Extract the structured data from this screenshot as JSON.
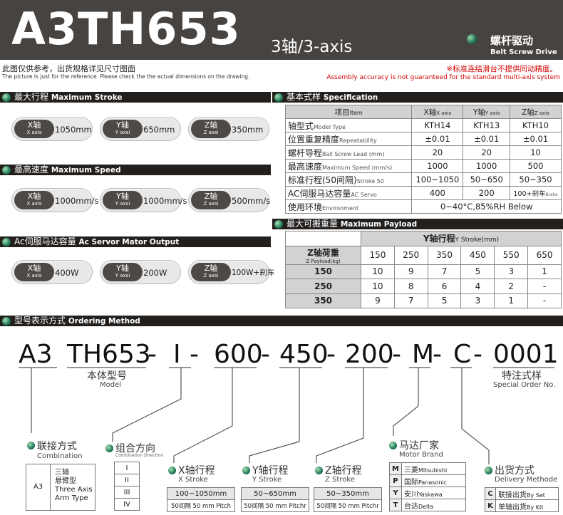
{
  "header": {
    "model": "A3TH653",
    "axis": "3轴/3-axis",
    "drive_cn": "螺杆驱动",
    "drive_en": "Belt Screw Drive"
  },
  "notes": {
    "picture_cn": "此图仅供参考，出货规格详见尺寸图面",
    "picture_en": "The picture is just for the reference. Please check the the actual dimensions on the drawing.",
    "warn_cn": "※标准连结滑台不提供同动精度。",
    "warn_en": "Assembly accuracy is not guaranteed for the standard multi-axis system"
  },
  "sections": {
    "stroke": {
      "cn": "最大行程",
      "en": "Maximum Stroke"
    },
    "speed": {
      "cn": "最高速度",
      "en": "Maximum Speed"
    },
    "servo": {
      "cn": "Ac伺服马达容量",
      "en": "Ac Servor Mator Output"
    },
    "spec": {
      "cn": "基本式样",
      "en": "Specification"
    },
    "payload": {
      "cn": "最大可搬重量",
      "en": "Maximum Payload"
    },
    "order": {
      "cn": "型号表示方式",
      "en": "Ordering Method"
    }
  },
  "stroke_pills": [
    {
      "cn": "X轴",
      "en": "X axis",
      "value": "1050mm"
    },
    {
      "cn": "Y轴",
      "en": "Y axsi",
      "value": "650mm"
    },
    {
      "cn": "Z轴",
      "en": "Z axsi",
      "value": "350mm"
    }
  ],
  "speed_pills": [
    {
      "cn": "X轴",
      "en": "X axis",
      "value": "1000mm/s"
    },
    {
      "cn": "Y轴",
      "en": "Y axsi",
      "value": "1000mm/s"
    },
    {
      "cn": "Z轴",
      "en": "Z axsi",
      "value": "500mm/s"
    }
  ],
  "servo_pills": [
    {
      "cn": "X轴",
      "en": "X axis",
      "value": "400W"
    },
    {
      "cn": "Y轴",
      "en": "Y axsi",
      "value": "200W"
    },
    {
      "cn": "Z轴",
      "en": "Z axsi",
      "value": "100W+刹车"
    }
  ],
  "spec_table": {
    "headers": [
      {
        "cn": "项目",
        "en": "Item"
      },
      {
        "cn": "X轴",
        "en": "X axis"
      },
      {
        "cn": "Y轴",
        "en": "Y axis"
      },
      {
        "cn": "Z轴",
        "en": "Z axis"
      }
    ],
    "rows": [
      {
        "cn": "轴型式",
        "en": "Model Type",
        "x": "KTH14",
        "y": "KTH13",
        "z": "KTH10"
      },
      {
        "cn": "位置重复精度",
        "en": "Repeatability",
        "x": "±0.01",
        "y": "±0.01",
        "z": "±0.01"
      },
      {
        "cn": "螺杆导程",
        "en": "Ball Screw Lead (mm)",
        "x": "20",
        "y": "20",
        "z": "10"
      },
      {
        "cn": "最高速度",
        "en": "Maximum Speed (mm/s)",
        "x": "1000",
        "y": "1000",
        "z": "500"
      },
      {
        "cn": "标准行程(50间隔)",
        "en": "Stroke 50",
        "x": "100~1050",
        "y": "50~650",
        "z": "50~350"
      },
      {
        "cn": "AC伺服马达容量",
        "en": "AC Servo",
        "x": "400",
        "y": "200",
        "z": "100+刹车",
        "z_small": "Brake"
      }
    ],
    "env": {
      "cn": "使用环境",
      "en": "Environment",
      "value": "0~40°C,85%RH Below"
    }
  },
  "payload_table": {
    "y_header": {
      "cn": "Y轴行程",
      "en": "Y Stroke(mm)"
    },
    "z_header": {
      "cn": "Z轴荷重",
      "en": "Z Payload(kg)"
    },
    "y_strokes": [
      "150",
      "250",
      "350",
      "450",
      "550",
      "650"
    ],
    "rows": [
      {
        "z": "150",
        "values": [
          "10",
          "9",
          "7",
          "5",
          "3",
          "1"
        ]
      },
      {
        "z": "250",
        "values": [
          "10",
          "8",
          "6",
          "4",
          "2",
          "-"
        ]
      },
      {
        "z": "350",
        "values": [
          "9",
          "7",
          "5",
          "3",
          "1",
          "-"
        ]
      }
    ]
  },
  "ordering": {
    "code_parts": [
      "A3",
      "TH653",
      "-",
      "I",
      "-",
      "600",
      "-",
      "450",
      "-",
      "200",
      "-",
      "M",
      "-",
      "C",
      "-",
      "0001"
    ],
    "model_cn": "本体型号",
    "model_en": "Model",
    "special_cn": "特注式样",
    "special_en": "Special Order No.",
    "combination": {
      "cn": "联接方式",
      "en": "Combination",
      "code": "A3",
      "desc_cn1": "三轴",
      "desc_cn2": "悬臂型",
      "desc_en1": "Three Axis",
      "desc_en2": "Arm Type"
    },
    "direction": {
      "cn": "组合方向",
      "en": "Combination Direction",
      "items": [
        "I",
        "II",
        "III",
        "IV"
      ]
    },
    "x_stroke": {
      "cn": "X轴行程",
      "en": "X Stroke",
      "range": "100~1050mm",
      "pitch": "50间隔 50 mm Pitch"
    },
    "y_stroke": {
      "cn": "Y轴行程",
      "en": "Y Stroke",
      "range": "50~650mm",
      "pitch": "50间隔 50 mm Pitchr"
    },
    "z_stroke": {
      "cn": "Z轴行程",
      "en": "Z Stroke",
      "range": "50~350mm",
      "pitch": "50间隔 50 mm Pitchr"
    },
    "motor": {
      "cn": "马达厂家",
      "en": "Motor Brand",
      "items": [
        {
          "k": "M",
          "cn": "三菱",
          "en": "Mitsubishi"
        },
        {
          "k": "P",
          "cn": "国际",
          "en": "Panasonic"
        },
        {
          "k": "Y",
          "cn": "安川",
          "en": "Yaskawa"
        },
        {
          "k": "T",
          "cn": "台达",
          "en": "Delta"
        }
      ]
    },
    "delivery": {
      "cn": "出货方式",
      "en": "Delivery Methode",
      "items": [
        {
          "k": "C",
          "cn": "联接出货",
          "en": "By Set"
        },
        {
          "k": "K",
          "cn": "单轴出货",
          "en": "By Kit"
        }
      ]
    }
  }
}
